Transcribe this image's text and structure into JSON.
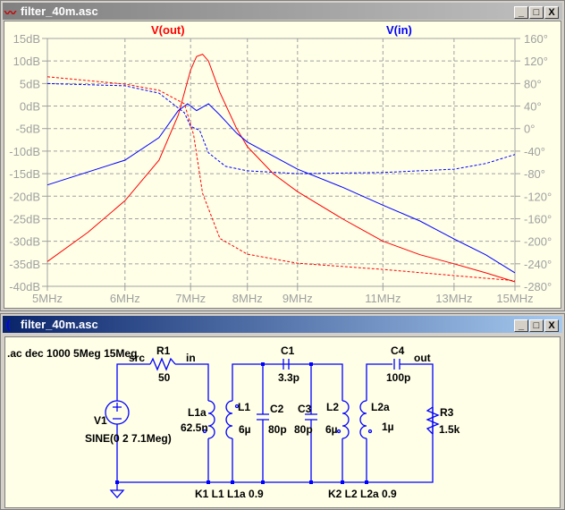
{
  "plot_window": {
    "title": "filter_40m.asc",
    "min": "_",
    "max": "□",
    "close": "X"
  },
  "schematic_window": {
    "title": "filter_40m.asc",
    "min": "_",
    "max": "□",
    "close": "X"
  },
  "chart_data": {
    "type": "line",
    "traces": [
      {
        "name": "V(out)",
        "color": "#ff0000"
      },
      {
        "name": "V(in)",
        "color": "#0000ff"
      }
    ],
    "xscale": "log",
    "xlim": [
      5,
      15
    ],
    "x_ticks": [
      "5MHz",
      "6MHz",
      "7MHz",
      "8MHz",
      "9MHz",
      "11MHz",
      "13MHz",
      "15MHz"
    ],
    "x_tick_values": [
      5,
      6,
      7,
      8,
      9,
      11,
      13,
      15
    ],
    "ylim": [
      -40,
      15
    ],
    "y_ticks": [
      "15dB",
      "10dB",
      "5dB",
      "0dB",
      "-5dB",
      "-10dB",
      "-15dB",
      "-20dB",
      "-25dB",
      "-30dB",
      "-35dB",
      "-40dB"
    ],
    "y2lim": [
      -280,
      160
    ],
    "y2_ticks": [
      "160°",
      "120°",
      "80°",
      "40°",
      "0°",
      "-40°",
      "-80°",
      "-120°",
      "-160°",
      "-200°",
      "-240°",
      "-280°"
    ],
    "series": [
      {
        "name": "V(out) magnitude",
        "color": "#ff0000",
        "axis": "dB",
        "dash": false,
        "x": [
          5,
          5.5,
          6,
          6.5,
          6.8,
          7.0,
          7.1,
          7.2,
          7.3,
          7.5,
          7.8,
          8,
          8.5,
          9,
          10,
          11,
          12,
          13,
          14,
          15
        ],
        "y": [
          -34.5,
          -28,
          -21,
          -12,
          -2,
          8,
          11,
          11.5,
          10,
          3,
          -5,
          -9,
          -15,
          -19,
          -25,
          -30,
          -33,
          -35,
          -37,
          -39
        ]
      },
      {
        "name": "V(in) magnitude",
        "color": "#0000ff",
        "axis": "dB",
        "dash": false,
        "x": [
          5,
          6,
          6.5,
          6.8,
          6.95,
          7.1,
          7.3,
          7.5,
          7.8,
          8,
          9,
          10,
          11,
          12,
          13,
          14,
          15
        ],
        "y": [
          -17.5,
          -12,
          -7,
          -1,
          0.5,
          -1,
          0.5,
          -2,
          -6,
          -8,
          -14,
          -18,
          -22,
          -25.5,
          -29.5,
          -33,
          -37
        ]
      },
      {
        "name": "V(out) phase",
        "color": "#ff0000",
        "axis": "deg",
        "dash": true,
        "x": [
          5,
          6,
          6.5,
          6.9,
          7.05,
          7.2,
          7.5,
          8,
          9,
          11,
          13,
          15
        ],
        "y": [
          92,
          79,
          68,
          44,
          -11,
          -115,
          -195,
          -223,
          -239,
          -250,
          -261,
          -270
        ]
      },
      {
        "name": "V(in) phase",
        "color": "#0000ff",
        "axis": "deg",
        "dash": true,
        "x": [
          5,
          6,
          6.5,
          6.9,
          7.0,
          7.15,
          7.3,
          7.6,
          8,
          9,
          11,
          13,
          14,
          15
        ],
        "y": [
          80,
          76,
          63,
          28,
          4,
          -3,
          -43,
          -67,
          -75,
          -80,
          -78,
          -72,
          -62,
          -46
        ]
      }
    ]
  },
  "schematic": {
    "directive": ".ac dec 1000 5Meg 15Meg",
    "labels": {
      "src": "src",
      "in": "in",
      "out": "out"
    },
    "R1": {
      "name": "R1",
      "value": "50"
    },
    "R3": {
      "name": "R3",
      "value": "1.5k"
    },
    "V1": {
      "name": "V1",
      "value": "SINE(0 2 7.1Meg)"
    },
    "L1a": {
      "name": "L1a",
      "value": "62.5n"
    },
    "L1": {
      "name": "L1",
      "value": "6µ"
    },
    "C2": {
      "name": "C2",
      "value": "80p"
    },
    "C1": {
      "name": "C1",
      "value": "3.3p"
    },
    "C3": {
      "name": "C3",
      "value": "80p"
    },
    "L2": {
      "name": "L2",
      "value": "6µ"
    },
    "L2a": {
      "name": "L2a",
      "value": "1µ"
    },
    "C4": {
      "name": "C4",
      "value": "100p"
    },
    "K1": "K1 L1 L1a 0.9",
    "K2": "K2 L2 L2a 0.9"
  }
}
